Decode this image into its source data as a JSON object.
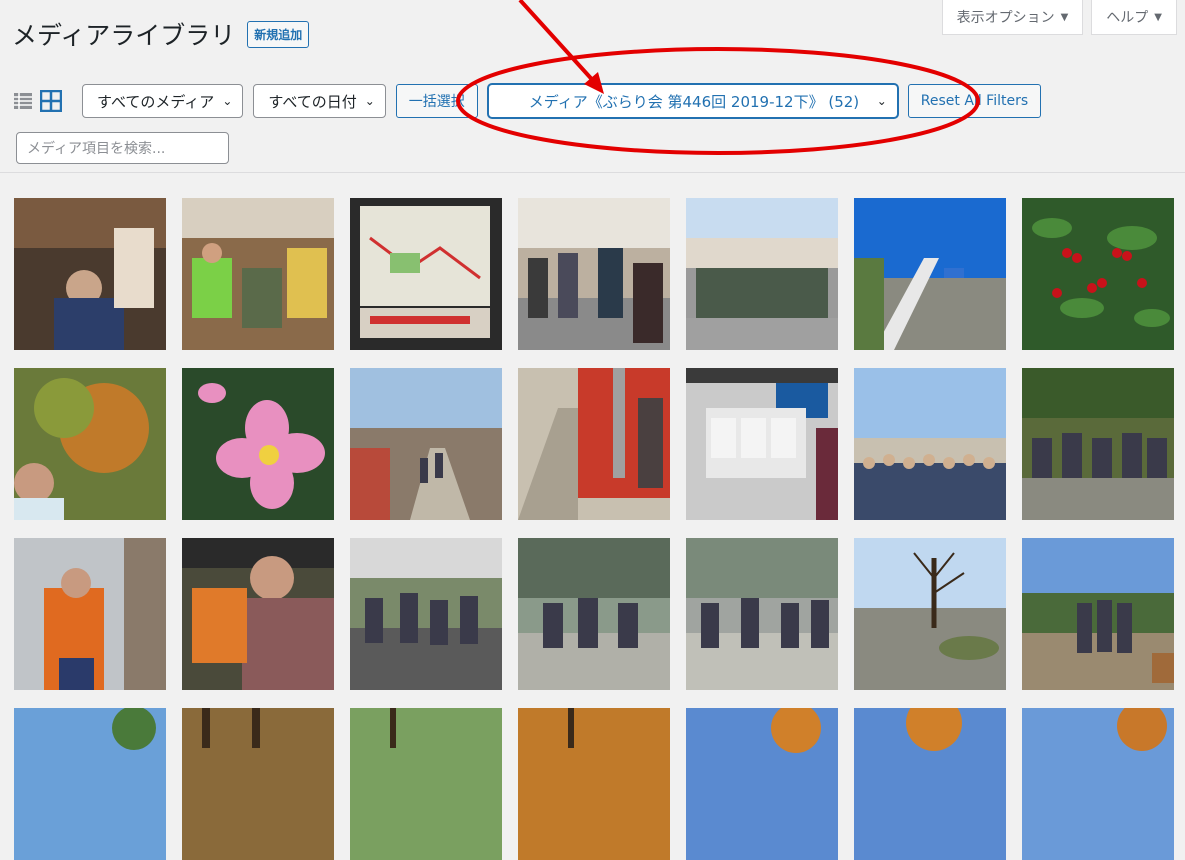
{
  "header": {
    "title": "メディアライブラリ",
    "add_new": "新規追加",
    "screen_options": "表示オプション",
    "help": "ヘルプ"
  },
  "filters": {
    "media_type": "すべてのメディア",
    "date": "すべての日付",
    "bulk_select": "一括選択",
    "category": "メディア《ぶらり会 第446回 2019-12下》 (52)",
    "reset": "Reset All Filters"
  },
  "search": {
    "placeholder": "メディア項目を検索..."
  },
  "icons": {
    "list_view": "list-view-icon",
    "grid_view": "grid-view-icon"
  },
  "colors": {
    "accent": "#2271b1",
    "annotation": "#e30000"
  }
}
